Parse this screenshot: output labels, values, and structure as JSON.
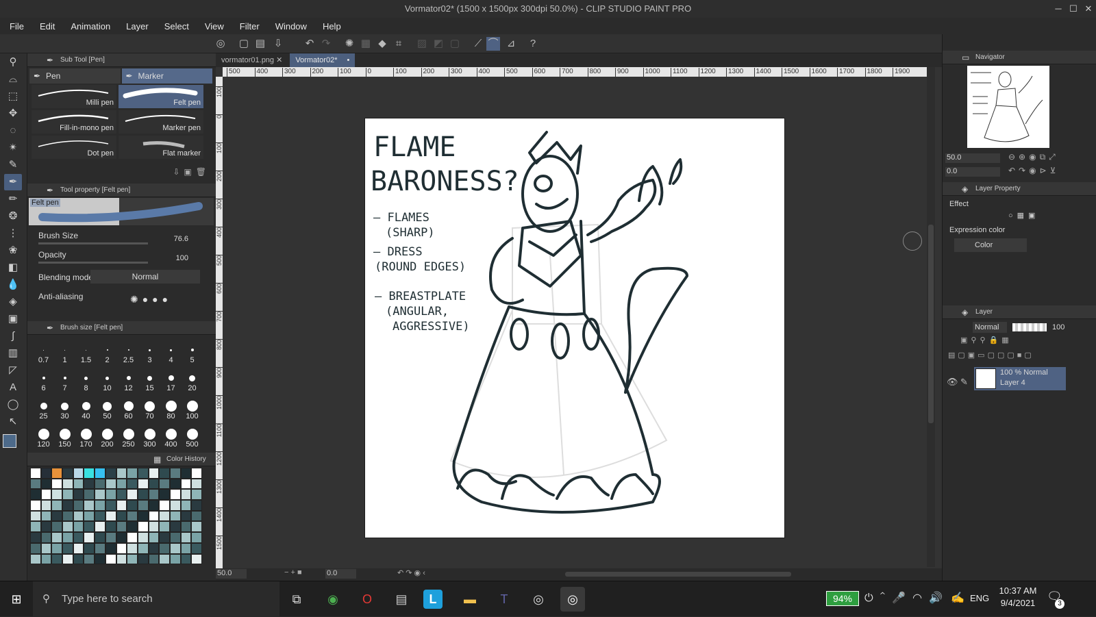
{
  "window": {
    "title": "Vormator02* (1500 x 1500px 300dpi 50.0%) - CLIP STUDIO PAINT PRO"
  },
  "menu": [
    "File",
    "Edit",
    "Animation",
    "Layer",
    "Select",
    "View",
    "Filter",
    "Window",
    "Help"
  ],
  "subtool": {
    "header": "Sub Tool [Pen]",
    "tabs": [
      "Pen",
      "Marker"
    ],
    "brushes": [
      "Milli pen",
      "Felt pen",
      "Fill-in-mono pen",
      "Marker pen",
      "Dot pen",
      "Flat marker"
    ]
  },
  "toolprop": {
    "header": "Tool property [Felt pen]",
    "preview_label": "Felt pen",
    "brush_size_label": "Brush Size",
    "brush_size": "76.6",
    "opacity_label": "Opacity",
    "opacity": "100",
    "blend_label": "Blending mode",
    "blend": "Normal",
    "aa_label": "Anti-aliasing"
  },
  "brushsize": {
    "header": "Brush size [Felt pen]",
    "sizes": [
      "0.7",
      "1",
      "1.5",
      "2",
      "2.5",
      "3",
      "4",
      "5",
      "6",
      "7",
      "8",
      "10",
      "12",
      "15",
      "17",
      "20",
      "25",
      "30",
      "40",
      "50",
      "60",
      "70",
      "80",
      "100",
      "120",
      "150",
      "170",
      "200",
      "250",
      "300",
      "400",
      "500"
    ]
  },
  "colorhistory": {
    "header": "Color History"
  },
  "doc": {
    "tabs": [
      "vormator01.png",
      "Vormator02*"
    ],
    "ruler_h": [
      "500",
      "400",
      "300",
      "200",
      "100",
      "0",
      "100",
      "200",
      "300",
      "400",
      "500",
      "600",
      "700",
      "800",
      "900",
      "1000",
      "1100",
      "1200",
      "1300",
      "1400",
      "1500",
      "1600",
      "1700",
      "1800",
      "1900"
    ],
    "ruler_v": [
      "100",
      "0",
      "100",
      "200",
      "300",
      "400",
      "500",
      "600",
      "700",
      "800",
      "900",
      "1000",
      "1100",
      "1200",
      "1300",
      "1400",
      "1500"
    ],
    "sketch_title": [
      "FLAME",
      "BARONESS?"
    ],
    "notes": [
      "— FLAMES",
      "(SHARP)",
      "— DRESS",
      "(ROUND EDGES)",
      "— BREASTPLATE",
      "(ANGULAR,",
      "AGGRESSIVE)"
    ],
    "status_zoom": "50.0",
    "status_angle": "0.0"
  },
  "navigator": {
    "header": "Navigator",
    "zoom": "50.0",
    "angle": "0.0"
  },
  "layerprop": {
    "header": "Layer Property",
    "effect": "Effect",
    "expr_label": "Expression color",
    "expr_value": "Color"
  },
  "layer": {
    "header": "Layer",
    "blend": "Normal",
    "opacity": "100",
    "item_mode": "100 % Normal",
    "item_name": "Layer 4"
  },
  "taskbar": {
    "search_placeholder": "Type here to search",
    "battery": "94%",
    "lang": "ENG",
    "time": "10:37 AM",
    "date": "9/4/2021",
    "notif": "3"
  },
  "colors": {
    "accent": "#4f6283",
    "paper": "#ffffff",
    "ink": "#1f2e33",
    "history": [
      "#ffffff",
      "#262f38",
      "#e8923a",
      "#2a3a40",
      "#b8d8e8",
      "#39e0e0",
      "#36c0f0",
      "#2a4048"
    ]
  }
}
